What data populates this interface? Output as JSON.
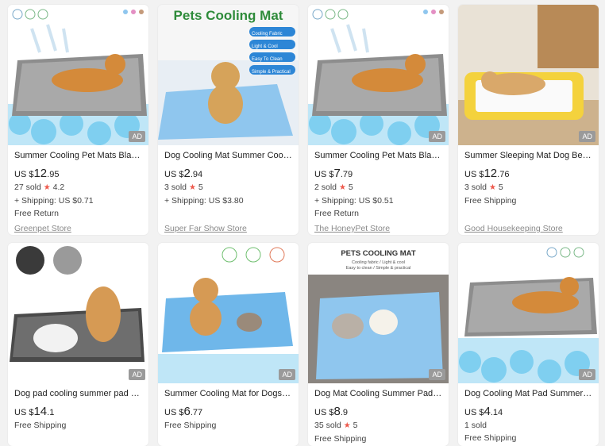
{
  "badge_ad": "AD",
  "products": [
    {
      "title": "Summer Cooling Pet Mats Blanket ...",
      "currency": "US $",
      "price_int": "12",
      "price_dec": ".95",
      "sold": "27 sold",
      "rating": "4.2",
      "shipping": "+ Shipping: US $0.71",
      "extra": "Free Return",
      "store": "Greenpet Store"
    },
    {
      "title": "Dog Cooling Mat Summer Cooling ...",
      "currency": "US $",
      "price_int": "2",
      "price_dec": ".94",
      "sold": "3 sold",
      "rating": "5",
      "shipping": "+ Shipping: US $3.80",
      "extra": "",
      "store": "Super Far Show Store"
    },
    {
      "title": "Summer Cooling Pet Mats Blanket ...",
      "currency": "US $",
      "price_int": "7",
      "price_dec": ".79",
      "sold": "2 sold",
      "rating": "5",
      "shipping": "+ Shipping: US $0.51",
      "extra": "Free Return",
      "store": "The HoneyPet Store"
    },
    {
      "title": "Summer Sleeping Mat Dog Beds C...",
      "currency": "US $",
      "price_int": "12",
      "price_dec": ".76",
      "sold": "3 sold",
      "rating": "5",
      "shipping": "Free Shipping",
      "extra": "",
      "store": "Good Housekeeping Store"
    },
    {
      "title": "Dog pad cooling summer pad dog ...",
      "currency": "US $",
      "price_int": "14",
      "price_dec": ".1",
      "sold": "",
      "rating": "",
      "shipping": "Free Shipping",
      "extra": "",
      "store": ""
    },
    {
      "title": "Summer Cooling Mat for Dogs Cat...",
      "currency": "US $",
      "price_int": "6",
      "price_dec": ".77",
      "sold": "",
      "rating": "",
      "shipping": "Free Shipping",
      "extra": "",
      "store": ""
    },
    {
      "title": "Dog Mat Cooling Summer Pad Mat...",
      "currency": "US $",
      "price_int": "8",
      "price_dec": ".9",
      "sold": "35 sold",
      "rating": "5",
      "shipping": "Free Shipping",
      "extra": "",
      "store": ""
    },
    {
      "title": "Dog Cooling Mat Pad Summer Dog...",
      "currency": "US $",
      "price_int": "4",
      "price_dec": ".14",
      "sold": "1 sold",
      "rating": "",
      "shipping": "Free Shipping",
      "extra": "",
      "store": ""
    }
  ],
  "image_text": {
    "pets_cooling_mat_title": "Pets Cooling Mat",
    "features": [
      "Cooling Fabric",
      "Light & Cool",
      "Easy To Clean",
      "Simple & Practical"
    ],
    "pets_cooling_mat_upper": "PETS COOLING MAT",
    "pets_cooling_mat_sub1": "Cooling fabric / Light & cool",
    "pets_cooling_mat_sub2": "Easy to clean / Simple & practical"
  },
  "colors": {
    "star": "#ee5a4d",
    "card_bg": "#ffffff",
    "page_bg": "#f2f2f2",
    "mat_blue": "#8fc6ee",
    "mat_gray": "#9a9a9a"
  }
}
